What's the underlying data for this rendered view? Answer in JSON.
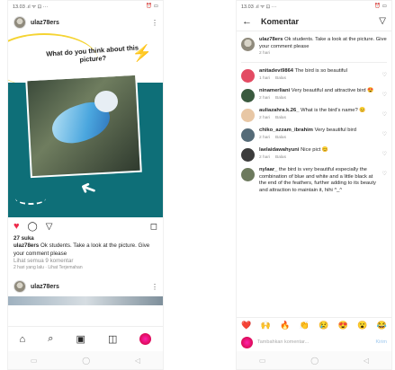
{
  "feed": {
    "status_time": "13.03",
    "status_icons_left": ".ıl ᯤ ⊡ ···",
    "status_icons_right": "⏰ ▭",
    "post1": {
      "username": "ulaz78ers",
      "headline": "What do you think about this picture?",
      "likes": "27 suka",
      "caption_user": "ulaz78ers",
      "caption_text": "Ok students. Take a look at the picture. Give your comment please",
      "view_all": "Lihat semua 9 komentar",
      "time": "2 hari yang lalu · Lihat Terjemahan"
    },
    "post2": {
      "username": "ulaz78ers"
    },
    "icons": {
      "heart": "♥",
      "comment": "◯",
      "share": "▽",
      "save": "◻",
      "more": "⋮"
    },
    "tabbar": {
      "home": "⌂",
      "search": "⌕",
      "reels": "▣",
      "shop": "◫"
    },
    "navbar": [
      "▭",
      "◯",
      "◁"
    ]
  },
  "comments_screen": {
    "status_time": "13.03",
    "status_icons_left": ".ıl ᯤ ⊡ ···",
    "status_icons_right": "⏰ ▭",
    "title": "Komentar",
    "back_icon": "←",
    "send_icon": "▽",
    "caption": {
      "user": "ulaz78ers",
      "text": "Ok students. Take a look at the picture. Give your comment please",
      "time": "2 hari"
    },
    "comments": [
      {
        "user": "anitadevi9864",
        "text": "The bird is so beautiful",
        "time": "1 hari",
        "reply": "Balas",
        "color": "#e34b63"
      },
      {
        "user": "ninamerliani",
        "text": "Very beautiful and attractive bird 😍",
        "time": "2 hari",
        "reply": "Balas",
        "color": "#3a5a3f"
      },
      {
        "user": "auliazahra.k.26_",
        "text": "What is the bird's name? 😊",
        "time": "2 hari",
        "reply": "Balas",
        "color": "#e8c7a5"
      },
      {
        "user": "chiko_azzam_ibrahim",
        "text": "Very beautiful bird",
        "time": "2 hari",
        "reply": "Balas",
        "color": "#556b78"
      },
      {
        "user": "laelaidawahyuni",
        "text": "Nice pict 😊",
        "time": "2 hari",
        "reply": "Balas",
        "color": "#3c3c3c"
      },
      {
        "user": "nylaar_",
        "text": "the bird is very beautiful especially the combination of blue and white and a little black at the end of the feathers, further adding to its beauty and attraction to maintain it, hihi ^_^",
        "time": "",
        "reply": "",
        "color": "#6d7a5e"
      }
    ],
    "emoji_bar": [
      "❤️",
      "🙌",
      "🔥",
      "👏",
      "😢",
      "😍",
      "😮",
      "😂"
    ],
    "composer_placeholder": "Tambahkan komentar...",
    "composer_post": "Kirim",
    "navbar": [
      "▭",
      "◯",
      "◁"
    ]
  }
}
